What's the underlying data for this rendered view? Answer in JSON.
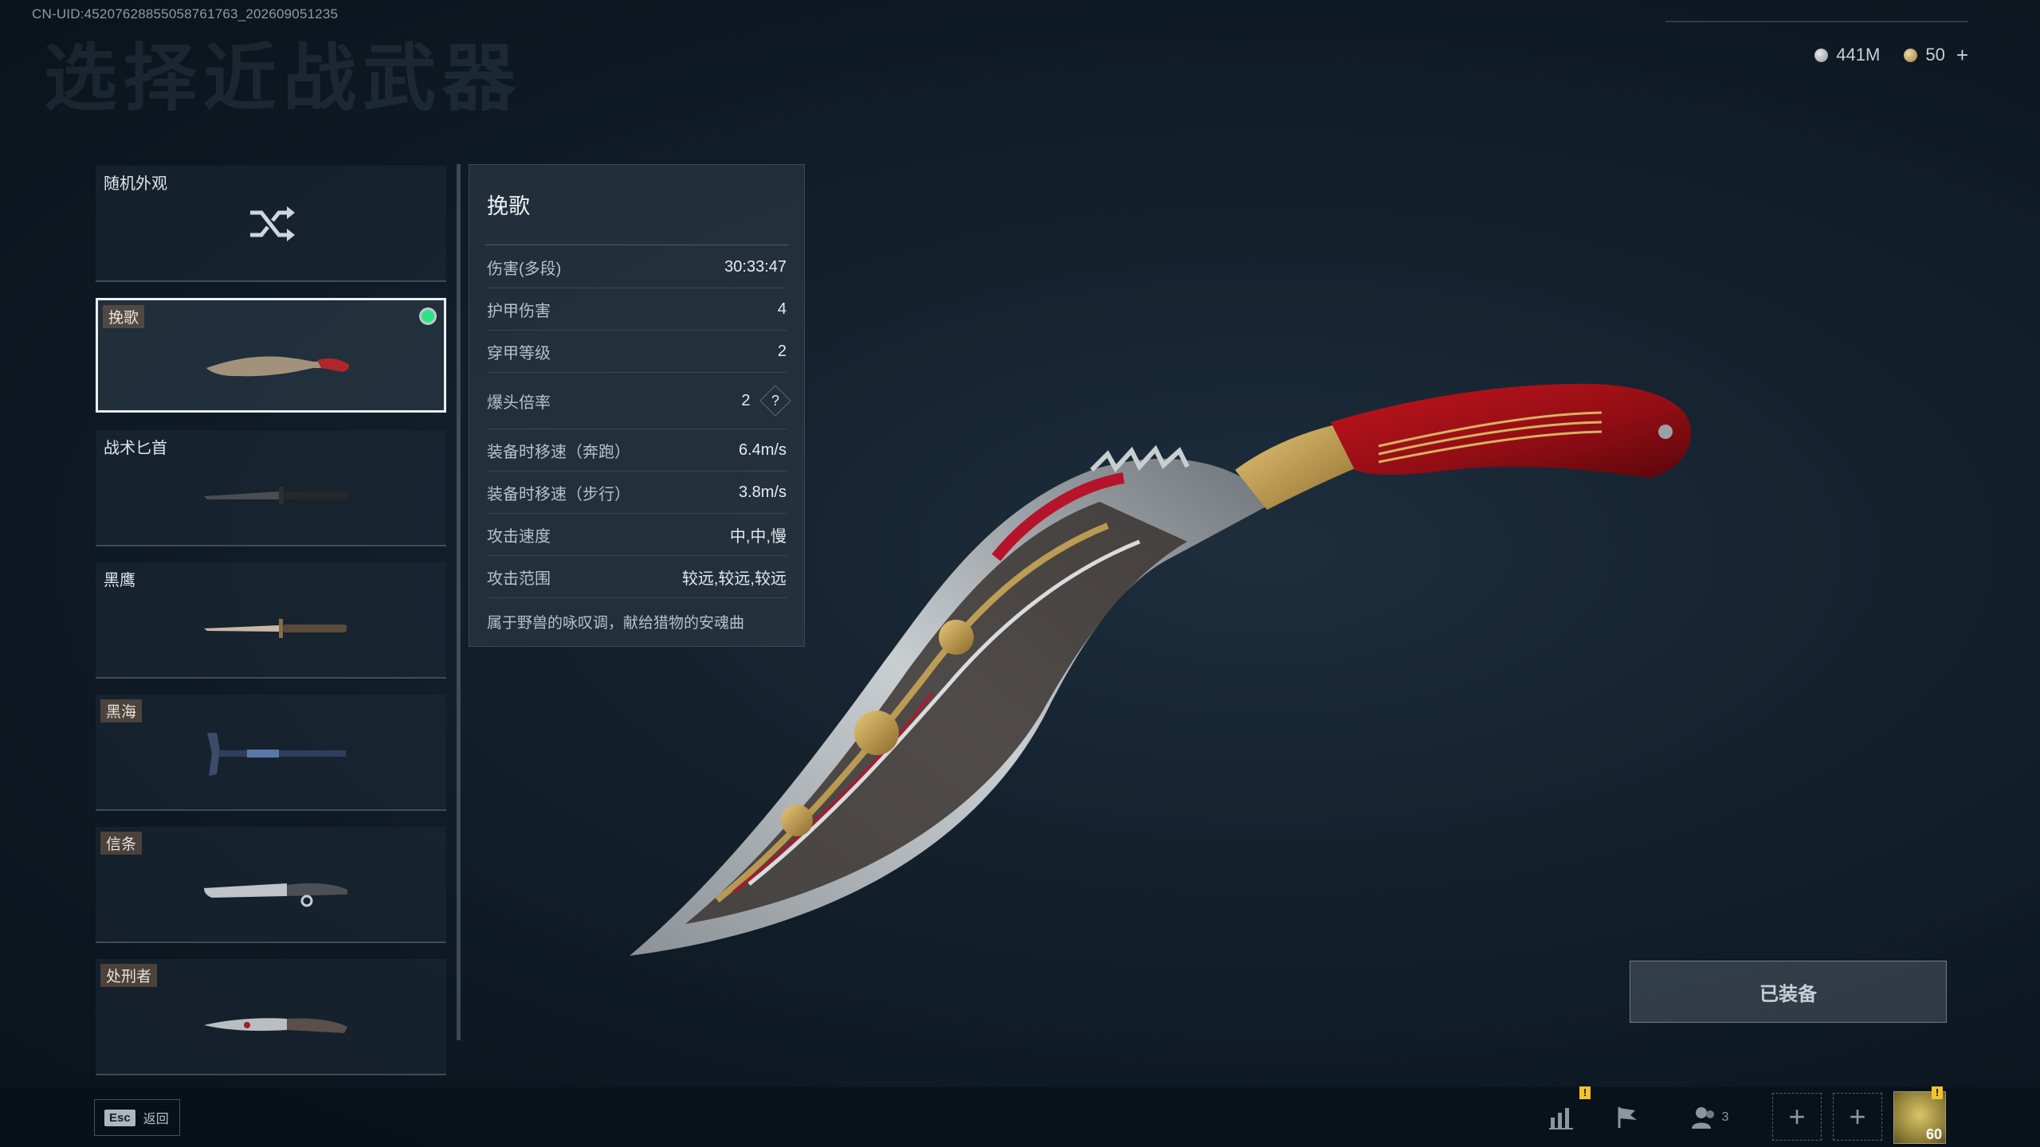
{
  "uid_text": "CN-UID:4520762885505876176​3_202609051235",
  "page_title": "选择近战武器",
  "currency": {
    "silver": "441M",
    "gold": "50",
    "add": "+"
  },
  "weapon_list": {
    "random_label": "随机外观",
    "items": [
      {
        "label": "挽歌",
        "tagged": true,
        "selected": true
      },
      {
        "label": "战术匕首",
        "tagged": false,
        "selected": false
      },
      {
        "label": "黑鹰",
        "tagged": false,
        "selected": false
      },
      {
        "label": "黑海",
        "tagged": true,
        "selected": false
      },
      {
        "label": "信条",
        "tagged": true,
        "selected": false
      },
      {
        "label": "处刑者",
        "tagged": true,
        "selected": false
      }
    ]
  },
  "detail": {
    "name": "挽歌",
    "stats": [
      {
        "key": "伤害(多段)",
        "value": "30:33:47"
      },
      {
        "key": "护甲伤害",
        "value": "4"
      },
      {
        "key": "穿甲等级",
        "value": "2"
      },
      {
        "key": "爆头倍率",
        "value": "2"
      },
      {
        "key": "装备时移速（奔跑）",
        "value": "6.4m/s"
      },
      {
        "key": "装备时移速（步行）",
        "value": "3.8m/s"
      },
      {
        "key": "攻击速度",
        "value": "中,中,慢"
      },
      {
        "key": "攻击范围",
        "value": "较远,较远,较远"
      }
    ],
    "help": "?",
    "description": "属于野兽的咏叹调，献给猎物的安魂曲"
  },
  "equipped_label": "已装备",
  "bottom": {
    "esc_key": "Esc",
    "esc_label": "返回",
    "friends_count": "3",
    "level": "60",
    "warn_mark": "!"
  },
  "icons": {
    "shuffle": "shuffle-icon",
    "stats": "bar-chart-icon",
    "flag": "flag-icon",
    "friends": "people-icon"
  },
  "colors": {
    "selected_dot": "#2ee28a",
    "warning": "#f2c233"
  }
}
